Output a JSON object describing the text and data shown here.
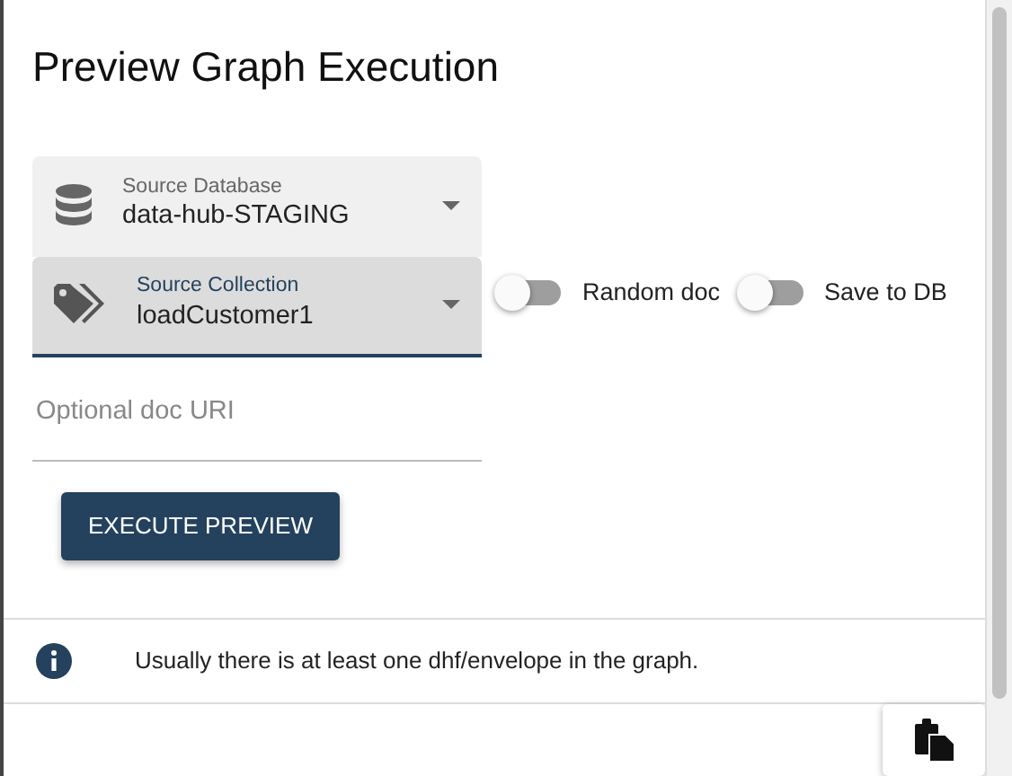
{
  "dialog": {
    "title": "Preview Graph Execution"
  },
  "selects": [
    {
      "kind": "database",
      "label": "Source Database",
      "value": "data-hub-STAGING",
      "focused": false
    },
    {
      "kind": "collection",
      "label": "Source Collection",
      "value": "loadCustomer1",
      "focused": true
    }
  ],
  "toggles": [
    {
      "label": "Random doc",
      "on": false
    },
    {
      "label": "Save to DB",
      "on": false
    }
  ],
  "uri_field": {
    "placeholder": "Optional doc URI"
  },
  "execute_button": "EXECUTE PREVIEW",
  "info": "Usually there is at least one dhf/envelope in the graph."
}
